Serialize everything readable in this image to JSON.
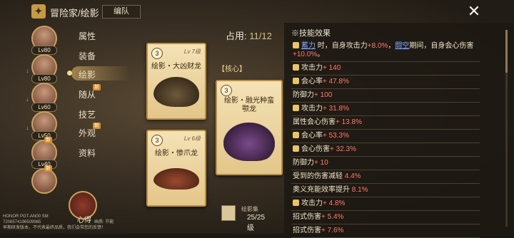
{
  "header": {
    "title": "冒险家/绘影",
    "formation_label": "编队"
  },
  "heroes": [
    {
      "level": "Lv80",
      "arrow": ""
    },
    {
      "level": "Lv80",
      "arrow": "↓"
    },
    {
      "level": "Lv60",
      "arrow": "↓"
    },
    {
      "level": "Lv50",
      "arrow": "↓"
    },
    {
      "level": "Lv40",
      "arrow": "",
      "tag": "新"
    },
    {
      "level": "",
      "arrow": "",
      "tag": "新"
    }
  ],
  "menu": {
    "items": [
      "属性",
      "装备",
      "绘影",
      "随从",
      "技艺",
      "外观",
      "资料"
    ],
    "active_index": 2,
    "new_tag": "新"
  },
  "occupy": {
    "label": "占用:",
    "value": "11/12"
  },
  "cards": [
    {
      "cost": "3",
      "level": "Lv 7级",
      "name": "绘影・大凶财龙"
    },
    {
      "cost": "3",
      "level": "Lv 6级",
      "name": "绘影・惨爪龙"
    },
    {
      "cost": "3",
      "level": "",
      "name": "绘影・融光种蛮颚龙"
    }
  ],
  "core_label": "【核心】",
  "collection": {
    "label": "绘影集",
    "value": "25/25级"
  },
  "bottom": {
    "label": "心得"
  },
  "panel": {
    "title": "※技能效果",
    "rows": [
      {
        "icon": true,
        "parts": [
          {
            "t": "蓄力",
            "c": "blue"
          },
          {
            "t": " 时，自身攻击力"
          },
          {
            "t": "+8.0%",
            "c": "red"
          },
          {
            "t": "，"
          },
          {
            "t": "闘空",
            "c": "blue"
          },
          {
            "t": "期间，自身会心伤害"
          },
          {
            "t": "+10.0%",
            "c": "red"
          },
          {
            "t": "。"
          }
        ]
      },
      {
        "icon": true,
        "parts": [
          {
            "t": "攻击力"
          },
          {
            "t": "+ 140",
            "c": "red"
          }
        ]
      },
      {
        "icon": true,
        "parts": [
          {
            "t": "会心率"
          },
          {
            "t": "+ 47.8%",
            "c": "red"
          }
        ]
      },
      {
        "icon": false,
        "parts": [
          {
            "t": "防御力"
          },
          {
            "t": "+ 100",
            "c": "red"
          }
        ]
      },
      {
        "icon": true,
        "parts": [
          {
            "t": "攻击力"
          },
          {
            "t": "+ 31.8%",
            "c": "red"
          }
        ]
      },
      {
        "icon": false,
        "parts": [
          {
            "t": "属性会心伤害"
          },
          {
            "t": "+ 13.8%",
            "c": "red"
          }
        ]
      },
      {
        "icon": true,
        "parts": [
          {
            "t": "会心率"
          },
          {
            "t": "+ 53.3%",
            "c": "red"
          }
        ]
      },
      {
        "icon": true,
        "parts": [
          {
            "t": "会心伤害"
          },
          {
            "t": "+ 32.3%",
            "c": "red"
          }
        ]
      },
      {
        "icon": false,
        "parts": [
          {
            "t": "防御力"
          },
          {
            "t": "+ 10",
            "c": "red"
          }
        ]
      },
      {
        "icon": false,
        "parts": [
          {
            "t": "受到的伤害减轻"
          },
          {
            "t": " 4.4%",
            "c": "red"
          }
        ]
      },
      {
        "icon": false,
        "parts": [
          {
            "t": "奥义充能效率提升"
          },
          {
            "t": " 8.1%",
            "c": "red"
          }
        ]
      },
      {
        "icon": true,
        "parts": [
          {
            "t": "攻击力"
          },
          {
            "t": "+ 4.8%",
            "c": "red"
          }
        ]
      },
      {
        "icon": false,
        "parts": [
          {
            "t": "招式伤害"
          },
          {
            "t": "+ 5.4%",
            "c": "red"
          }
        ]
      },
      {
        "icon": false,
        "parts": [
          {
            "t": "招式伤害"
          },
          {
            "t": "+ 7.6%",
            "c": "red"
          }
        ]
      }
    ]
  },
  "footer": {
    "line1": "HONOR PGT-AN00 SM",
    "line2": "7208574196509965",
    "line3": "早期研发版本，不代表最终品质，我们会带您的反馈！",
    "extra": "画质: 节能"
  }
}
